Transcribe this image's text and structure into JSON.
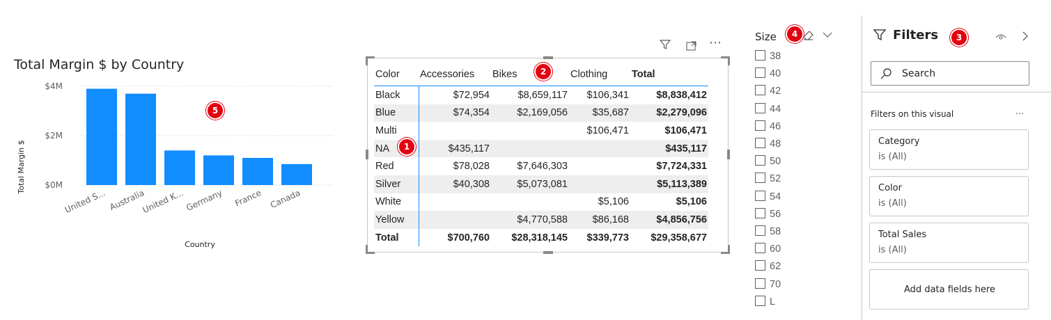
{
  "badges": {
    "one": "1",
    "two": "2",
    "three": "3",
    "four": "4",
    "five": "5"
  },
  "colors": {
    "bar": "#118dff",
    "accent": "#118dff",
    "badge": "#e3000f"
  },
  "chart": {
    "title": "Total Margin $ by Country",
    "xlabel": "Country",
    "ylabel": "Total Margin $"
  },
  "chart_data": {
    "type": "bar",
    "title": "Total Margin $ by Country",
    "xlabel": "Country",
    "ylabel": "Total Margin $",
    "categories": [
      "United S...",
      "Australia",
      "United K...",
      "Germany",
      "France",
      "Canada"
    ],
    "values": [
      3.9,
      3.7,
      1.4,
      1.2,
      1.1,
      0.85
    ],
    "units": "millions",
    "ylim": [
      0,
      4
    ],
    "yticks": [
      "$0M",
      "$2M",
      "$4M"
    ],
    "grid": true
  },
  "matrix": {
    "headers": [
      "Color",
      "Accessories",
      "Bikes",
      "Clothing",
      "Total"
    ],
    "rows": [
      {
        "color": "Black",
        "acc": "$72,954",
        "bikes": "$8,659,117",
        "cloth": "$106,341",
        "total": "$8,838,412"
      },
      {
        "color": "Blue",
        "acc": "$74,354",
        "bikes": "$2,169,056",
        "cloth": "$35,687",
        "total": "$2,279,096"
      },
      {
        "color": "Multi",
        "acc": "",
        "bikes": "",
        "cloth": "$106,471",
        "total": "$106,471"
      },
      {
        "color": "NA",
        "acc": "$435,117",
        "bikes": "",
        "cloth": "",
        "total": "$435,117"
      },
      {
        "color": "Red",
        "acc": "$78,028",
        "bikes": "$7,646,303",
        "cloth": "",
        "total": "$7,724,331"
      },
      {
        "color": "Silver",
        "acc": "$40,308",
        "bikes": "$5,073,081",
        "cloth": "",
        "total": "$5,113,389"
      },
      {
        "color": "White",
        "acc": "",
        "bikes": "",
        "cloth": "$5,106",
        "total": "$5,106"
      },
      {
        "color": "Yellow",
        "acc": "",
        "bikes": "$4,770,588",
        "cloth": "$86,168",
        "total": "$4,856,756"
      }
    ],
    "total": {
      "color": "Total",
      "acc": "$700,760",
      "bikes": "$28,318,145",
      "cloth": "$339,773",
      "total": "$29,358,677"
    },
    "icons": {
      "filter": "filter-icon",
      "focus": "focus-mode-icon",
      "more": "more-options-icon"
    }
  },
  "slicer": {
    "title": "Size",
    "items": [
      "38",
      "40",
      "42",
      "44",
      "46",
      "48",
      "50",
      "52",
      "54",
      "56",
      "58",
      "60",
      "62",
      "70",
      "L"
    ]
  },
  "filters": {
    "title": "Filters",
    "search_placeholder": "Search",
    "section": "Filters on this visual",
    "section_more": "...",
    "cards": [
      {
        "name": "Category",
        "value": "is (All)"
      },
      {
        "name": "Color",
        "value": "is (All)"
      },
      {
        "name": "Total Sales",
        "value": "is (All)"
      }
    ],
    "add_fields": "Add data fields here"
  }
}
